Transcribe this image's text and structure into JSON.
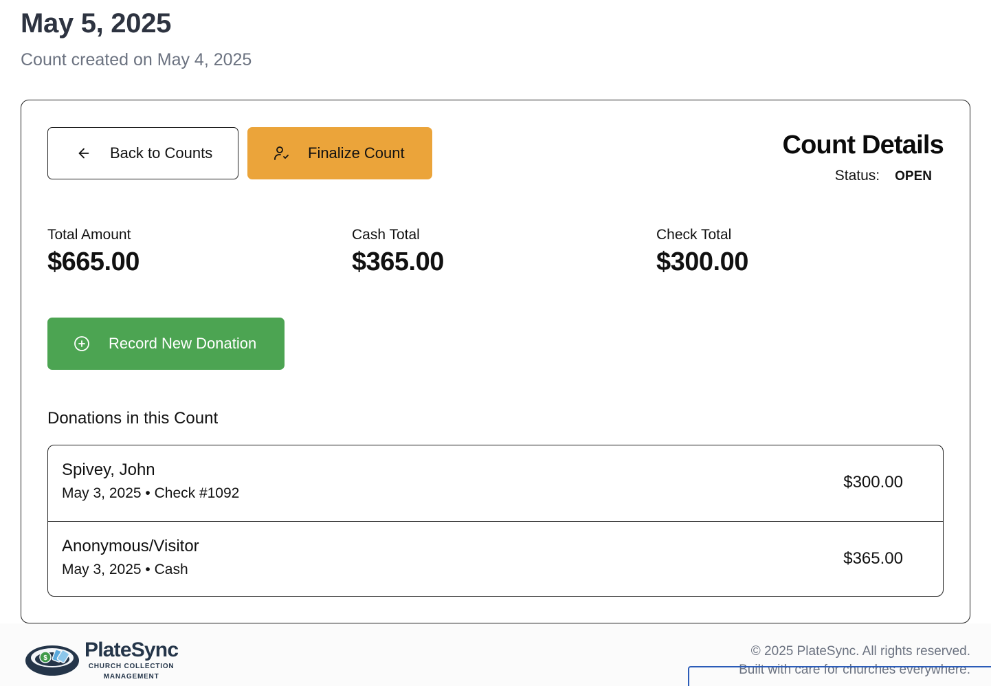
{
  "header": {
    "title": "May 5, 2025",
    "subtitle": "Count created on May 4, 2025"
  },
  "actions": {
    "back_label": "Back to Counts",
    "back_icon": "arrow-left-icon",
    "finalize_label": "Finalize Count",
    "finalize_icon": "user-check-icon",
    "record_label": "Record New Donation",
    "record_icon": "plus-circle-icon"
  },
  "details": {
    "title": "Count Details",
    "status_label": "Status:",
    "status_value": "OPEN"
  },
  "stats": {
    "total_label": "Total Amount",
    "total_value": "$665.00",
    "cash_label": "Cash Total",
    "cash_value": "$365.00",
    "check_label": "Check Total",
    "check_value": "$300.00"
  },
  "donations": {
    "heading": "Donations in this Count",
    "items": [
      {
        "name": "Spivey, John",
        "meta": "May 3, 2025 • Check #1092",
        "amount": "$300.00"
      },
      {
        "name": "Anonymous/Visitor",
        "meta": "May 3, 2025 • Cash",
        "amount": "$365.00"
      }
    ]
  },
  "footer": {
    "brand": "PlateSync",
    "tagline_line1": "CHURCH COLLECTION",
    "tagline_line2": "MANAGEMENT",
    "copyright": "© 2025 PlateSync. All rights reserved.",
    "built": "Built with care for churches everywhere."
  },
  "colors": {
    "finalize": "#eba43a",
    "record": "#4ca452",
    "title": "#2d3340",
    "muted": "#6b7280",
    "brand": "#243549"
  }
}
